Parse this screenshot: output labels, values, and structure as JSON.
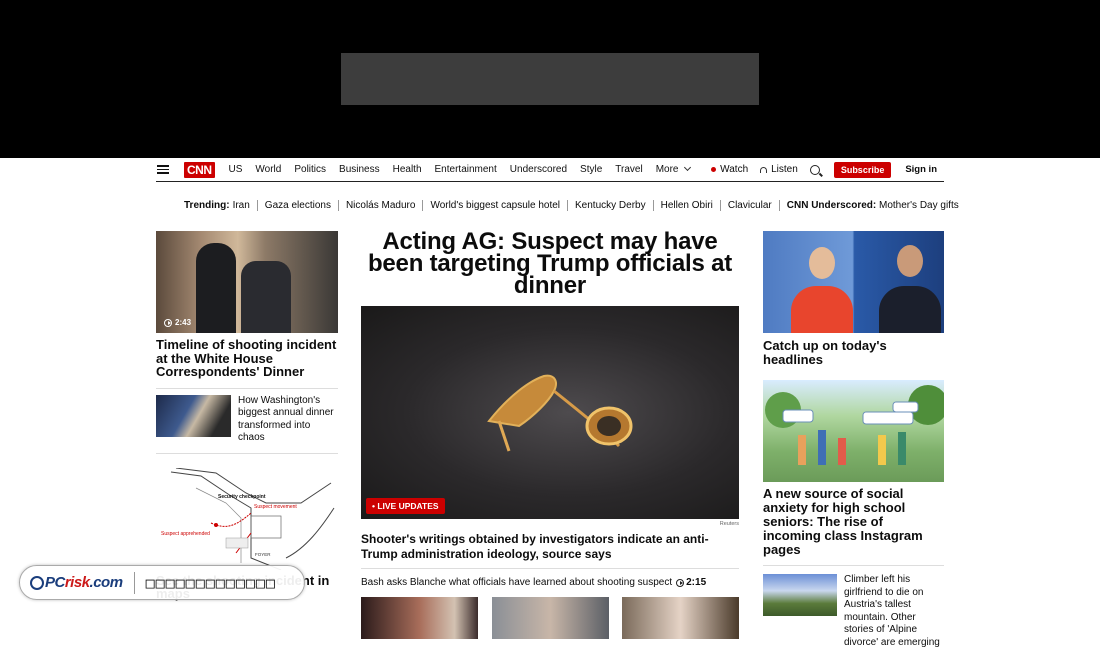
{
  "nav": {
    "logo": "CNN",
    "links": [
      "US",
      "World",
      "Politics",
      "Business",
      "Health",
      "Entertainment",
      "Underscored",
      "Style",
      "Travel"
    ],
    "more": "More",
    "watch": "Watch",
    "listen": "Listen",
    "subscribe": "Subscribe",
    "signin": "Sign in"
  },
  "trending": {
    "label": "Trending:",
    "items": [
      "Iran",
      "Gaza elections",
      "Nicolás Maduro",
      "World's biggest capsule hotel",
      "Kentucky Derby",
      "Hellen Obiri",
      "Clavicular"
    ],
    "underscored_label": "CNN Underscored:",
    "underscored_item": "Mother's Day gifts"
  },
  "left": {
    "video_duration": "2:43",
    "title": "Timeline of shooting incident at the White House Correspondents' Dinner",
    "small_story": "How Washington's biggest annual dinner transformed into chaos",
    "map_labels": {
      "security": "Security checkpoint",
      "movement": "Suspect movement",
      "apprehended": "Suspect apprehended",
      "foyer": "FOYER"
    },
    "map_caption": "See the shooting incident in maps"
  },
  "center": {
    "headline": "Acting AG: Suspect may have been targeting Trump officials at dinner",
    "live_badge": "• LIVE UPDATES",
    "credit": "Reuters",
    "caption": "Shooter's writings obtained by investigators indicate an anti-Trump administration ideology, source says",
    "bash_text": "Bash asks Blanche what officials have learned about shooting suspect",
    "bash_duration": "2:15"
  },
  "right": {
    "title1": "Catch up on today's headlines",
    "title2": "A new source of social anxiety for high school seniors: The rise of incoming class Instagram pages",
    "small_story": "Climber left his girlfriend to die on Austria's tallest mountain. Other stories of 'Alpine divorce' are emerging"
  },
  "watermark": {
    "brand_pc": "PC",
    "brand_risk": "risk",
    "brand_com": ".com",
    "text": "□□□□□□□□□□□□□"
  },
  "colors": {
    "accent": "#cc0000",
    "text": "#0c0c0c"
  }
}
